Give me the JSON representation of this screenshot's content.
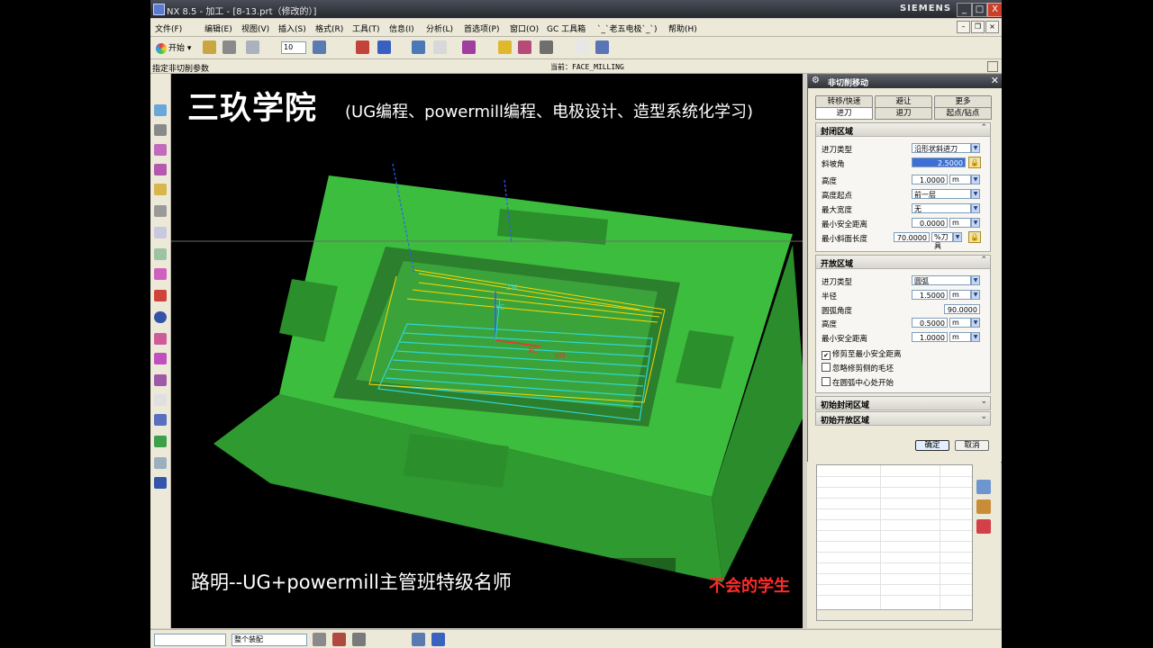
{
  "window": {
    "title": "NX 8.5 - 加工 - [8-13.prt（修改的）]",
    "brand": "SIEMENS",
    "minimize": "_",
    "maximize": "□",
    "close": "X"
  },
  "menubar": {
    "items": [
      "文件(F)",
      "编辑(E)",
      "视图(V)",
      "插入(S)",
      "格式(R)",
      "工具(T)",
      "信息(I)",
      "分析(L)",
      "首选项(P)",
      "窗口(O)",
      "GC 工具箱",
      "`_`老五电极`_`)",
      "帮助(H)"
    ]
  },
  "toolbar": {
    "start_label": "开始",
    "size_value": "10"
  },
  "status": {
    "prompt": "指定非切削参数",
    "current": "当前：FACE_MILLING"
  },
  "colors": {
    "part_green": "#3dbd3d",
    "toolpath_yellow": "#ffd400",
    "toolpath_cyan": "#2fd6d6",
    "accent_red": "#ff2a2a"
  },
  "overlay": {
    "title": "三玖学院",
    "subtitle": "(UG编程、powermill编程、电极设计、造型系统化学习)",
    "bottom": "路明--UG+powermill主管班特级名师",
    "red": "不会的学生",
    "wcs_labels": [
      "ZM",
      "YC",
      "XC",
      "XM"
    ]
  },
  "dialog": {
    "title": "非切削移动",
    "tabs_row1": [
      "转移/快速",
      "避让",
      "更多"
    ],
    "tabs_row2": [
      "进刀",
      "退刀",
      "起点/钻点"
    ],
    "closed_area": {
      "heading": "封闭区域",
      "rows": [
        {
          "label": "进刀类型",
          "value": "沿形状斜进刀"
        },
        {
          "label": "斜坡角",
          "value": "2.5000"
        },
        {
          "label": "高度",
          "value": "1.0000",
          "unit": "m"
        },
        {
          "label": "高度起点",
          "value": "前一层"
        },
        {
          "label": "最大宽度",
          "value": "无"
        },
        {
          "label": "最小安全距离",
          "value": "0.0000",
          "unit": "m"
        },
        {
          "label": "最小斜面长度",
          "value": "70.0000",
          "unit": "%刀具"
        }
      ]
    },
    "open_area": {
      "heading": "开放区域",
      "rows": [
        {
          "label": "进刀类型",
          "value": "圆弧"
        },
        {
          "label": "半径",
          "value": "1.5000",
          "unit": "m"
        },
        {
          "label": "圆弧角度",
          "value": "90.0000"
        },
        {
          "label": "高度",
          "value": "0.5000",
          "unit": "m"
        },
        {
          "label": "最小安全距离",
          "value": "1.0000",
          "unit": "m"
        }
      ],
      "checks": [
        {
          "label": "修剪至最小安全距离",
          "checked": true
        },
        {
          "label": "忽略修剪侧的毛坯",
          "checked": false
        },
        {
          "label": "在圆弧中心处开始",
          "checked": false
        }
      ]
    },
    "initial_closed": "初始封闭区域",
    "initial_open": "初始开放区域",
    "ok": "确定",
    "cancel": "取消"
  },
  "bottombar": {
    "filter_value": "",
    "scope_value": "整个装配"
  }
}
